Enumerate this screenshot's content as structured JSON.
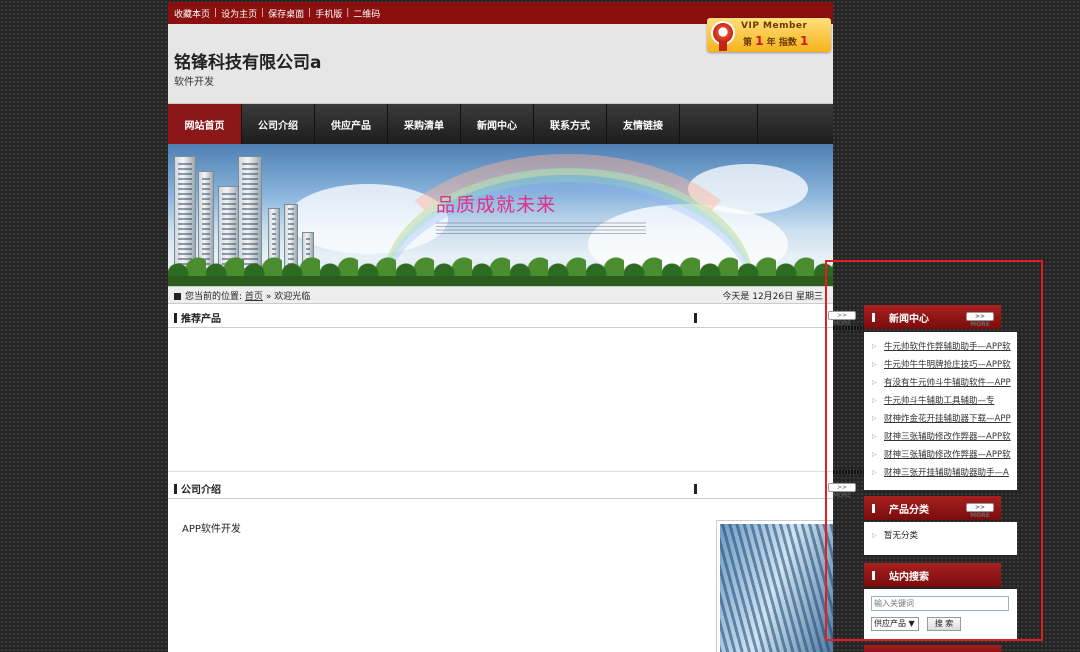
{
  "topbar": {
    "links": [
      "收藏本页",
      "设为主页",
      "保存桌面",
      "手机版",
      "二维码"
    ]
  },
  "header": {
    "company_name": "铭锋科技有限公司a",
    "company_sub": "软件开发"
  },
  "vip": {
    "title": "VIP Member",
    "year_prefix": "第",
    "year": "1",
    "year_suffix": "年",
    "index_label": "指数",
    "index": "1"
  },
  "nav": {
    "items": [
      "网站首页",
      "公司介绍",
      "供应产品",
      "采购清单",
      "新闻中心",
      "联系方式",
      "友情链接"
    ],
    "active_index": 0
  },
  "banner": {
    "slogan": "品质成就未来"
  },
  "location": {
    "prefix": "您当前的位置:",
    "home": "首页",
    "separator": "»",
    "current": "欢迎光临",
    "date_text": "今天是 12月26日 星期三"
  },
  "sections": {
    "recommended_title": "推荐产品",
    "intro_title": "公司介绍",
    "intro_text": "APP软件开发"
  },
  "sidebar": {
    "more_label": ">> MORE",
    "news": {
      "title": "新闻中心",
      "items": [
        "牛元帅软件作弊辅助助手—APP软",
        "牛元帅牛牛明牌抢庄技巧—APP软",
        "有没有牛元帅斗牛辅助软件—APP",
        "牛元帅斗牛辅助工具辅助—专",
        "财神炸金花开挂辅助器下载—APP",
        "财神三张辅助修改作弊器—APP软",
        "财神三张辅助修改作弊器—APP软",
        "财神三张开挂辅助辅助器助手—A"
      ]
    },
    "category": {
      "title": "产品分类",
      "empty_text": "暂无分类"
    },
    "search": {
      "title": "站内搜索",
      "placeholder": "输入关键词",
      "select_value": "供应产品",
      "button": "搜 索"
    }
  },
  "colors": {
    "brand_red": "#8a0f0f",
    "highlight_box": "#e02020",
    "slogan": "#e0318a"
  }
}
